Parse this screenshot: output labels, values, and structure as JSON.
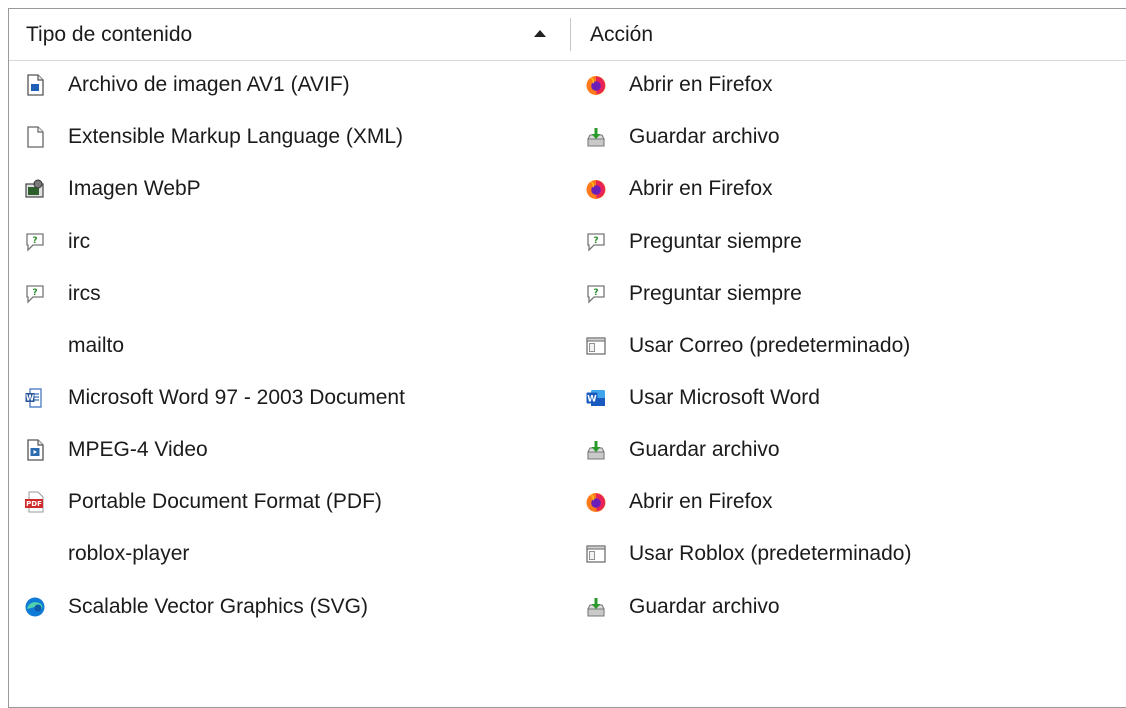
{
  "header": {
    "type_label": "Tipo de contenido",
    "action_label": "Acción",
    "sort": "ascending"
  },
  "rows": [
    {
      "type": "Archivo de imagen AV1 (AVIF)",
      "type_icon": "image-file-icon",
      "action": "Abrir en Firefox",
      "action_icon": "firefox-icon"
    },
    {
      "type": "Extensible Markup Language (XML)",
      "type_icon": "blank-document-icon",
      "action": "Guardar archivo",
      "action_icon": "save-file-icon"
    },
    {
      "type": "Imagen WebP",
      "type_icon": "image-viewer-icon",
      "action": "Abrir en Firefox",
      "action_icon": "firefox-icon"
    },
    {
      "type": "irc",
      "type_icon": "chat-bubble-icon",
      "action": "Preguntar siempre",
      "action_icon": "chat-bubble-icon"
    },
    {
      "type": "ircs",
      "type_icon": "chat-bubble-icon",
      "action": "Preguntar siempre",
      "action_icon": "chat-bubble-icon"
    },
    {
      "type": "mailto",
      "type_icon": "",
      "action": "Usar Correo (predeterminado)",
      "action_icon": "app-window-icon"
    },
    {
      "type": "Microsoft Word 97 - 2003 Document",
      "type_icon": "word-document-icon",
      "action": "Usar Microsoft Word",
      "action_icon": "word-app-icon"
    },
    {
      "type": "MPEG-4 Video",
      "type_icon": "video-file-icon",
      "action": "Guardar archivo",
      "action_icon": "save-file-icon"
    },
    {
      "type": "Portable Document Format (PDF)",
      "type_icon": "pdf-icon",
      "action": "Abrir en Firefox",
      "action_icon": "firefox-icon"
    },
    {
      "type": "roblox-player",
      "type_icon": "",
      "action": "Usar Roblox (predeterminado)",
      "action_icon": "app-window-icon"
    },
    {
      "type": "Scalable Vector Graphics (SVG)",
      "type_icon": "edge-icon",
      "action": "Guardar archivo",
      "action_icon": "save-file-icon"
    }
  ]
}
